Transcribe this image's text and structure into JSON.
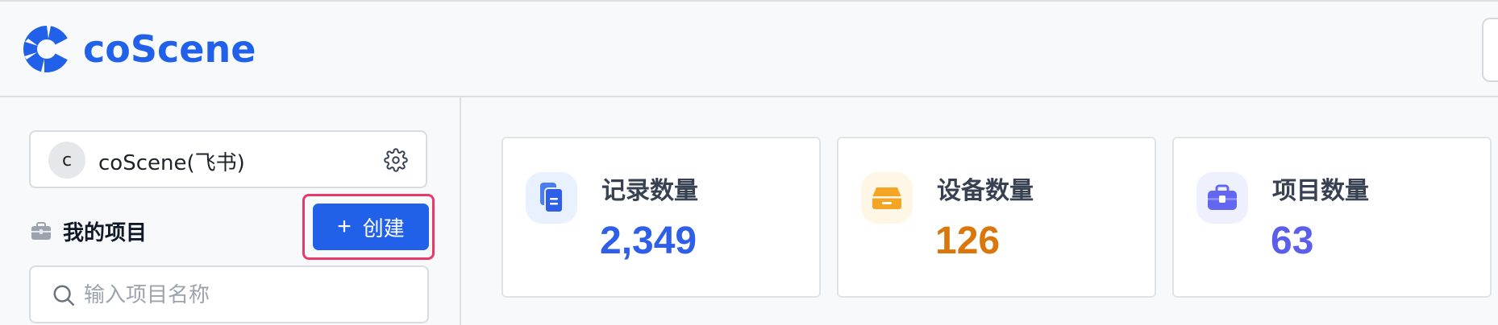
{
  "brand": {
    "name": "coScene",
    "accent": "#2160e8"
  },
  "org": {
    "avatar_letter": "c",
    "name": "coScene(飞书)"
  },
  "projects": {
    "title": "我的项目",
    "create_label": "创建",
    "create_icon": "plus-icon",
    "search_placeholder": "输入项目名称"
  },
  "stats": [
    {
      "label": "记录数量",
      "value": "2,349",
      "icon": "records-icon",
      "color": "#2f5fe8",
      "bg": "#e9f1fe"
    },
    {
      "label": "设备数量",
      "value": "126",
      "icon": "device-icon",
      "color": "#d9770c",
      "bg": "#fff7e6"
    },
    {
      "label": "项目数量",
      "value": "63",
      "icon": "briefcase-icon",
      "color": "#5b5ee8",
      "bg": "#eef0fe"
    }
  ]
}
